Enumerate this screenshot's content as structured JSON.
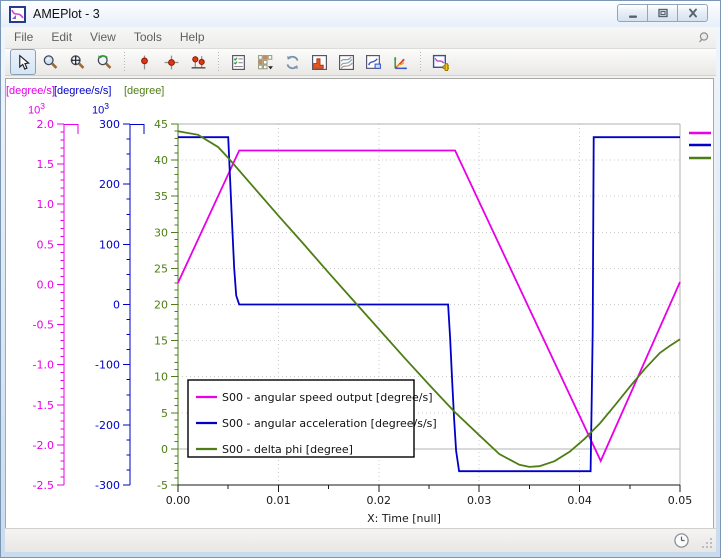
{
  "window": {
    "title": "AMEPlot - 3"
  },
  "menu": {
    "items": [
      "File",
      "Edit",
      "View",
      "Tools",
      "Help"
    ]
  },
  "toolbar": {
    "buttons": [
      {
        "name": "select-tool",
        "pressed": true
      },
      {
        "name": "zoom-tool",
        "pressed": false
      },
      {
        "name": "zoom-extents-tool",
        "pressed": false
      },
      {
        "name": "zoom-previous-tool",
        "pressed": false
      },
      {
        "name": "separator"
      },
      {
        "name": "cursor-x-tool",
        "pressed": false
      },
      {
        "name": "cursor-cross-tool",
        "pressed": false
      },
      {
        "name": "cursor-pair-tool",
        "pressed": false
      },
      {
        "name": "separator"
      },
      {
        "name": "curves-manager",
        "pressed": false
      },
      {
        "name": "layout-grid",
        "pressed": false
      },
      {
        "name": "refresh-plot",
        "pressed": false
      },
      {
        "name": "histogram-view",
        "pressed": false
      },
      {
        "name": "contour-view",
        "pressed": false
      },
      {
        "name": "copy-plot",
        "pressed": false
      },
      {
        "name": "plot-3d",
        "pressed": false
      },
      {
        "name": "separator"
      },
      {
        "name": "new-plot",
        "pressed": false
      }
    ]
  },
  "statusbar": {
    "icons": [
      "clock",
      "resize-grip"
    ]
  },
  "chart_data": {
    "type": "line",
    "title": "",
    "xlabel": "X: Time [null]",
    "grid": {
      "style": "dotted",
      "zero_line": "solid"
    },
    "x_axis": {
      "min": 0,
      "max": 0.05,
      "major": 0.01,
      "minor": 0.005,
      "tick_labels": [
        "0.00",
        "0.01",
        "0.02",
        "0.03",
        "0.04",
        "0.05"
      ]
    },
    "y_axes": [
      {
        "unit": "[degree/s]",
        "color": "#e800e8",
        "exponent": {
          "base": "10",
          "power": "3"
        },
        "min": -2.5,
        "max": 2.0,
        "major": 0.5,
        "minor": 0.1,
        "tick_labels": [
          "2.0",
          "1.5",
          "1.0",
          "0.5",
          "0.0",
          "-0.5",
          "-1.0",
          "-1.5",
          "-2.0",
          "-2.5"
        ]
      },
      {
        "unit": "[degree/s/s]",
        "color": "#0000c8",
        "exponent": {
          "base": "10",
          "power": "3"
        },
        "min": -300,
        "max": 300,
        "major": 100,
        "minor": 25,
        "tick_labels": [
          "300",
          "200",
          "100",
          "0",
          "-100",
          "-200",
          "-300"
        ]
      },
      {
        "unit": "[degree]",
        "color": "#4e7d15",
        "exponent": null,
        "min": -5,
        "max": 45,
        "major": 5,
        "minor": 1,
        "tick_labels": [
          "45",
          "40",
          "35",
          "30",
          "25",
          "20",
          "15",
          "10",
          "5",
          "0",
          "-5"
        ]
      }
    ],
    "legend": {
      "position": "inside-lower-left",
      "entries": [
        "S00 - angular speed output [degree/s]",
        "S00 - angular acceleration [degree/s/s]",
        "S00 - delta phi [degree]"
      ]
    },
    "series": [
      {
        "name": "S00 - angular speed output [degree/s]",
        "color": "#e800e8",
        "axis": 0,
        "unit_scale": "1e3",
        "points": [
          [
            0,
            0.02
          ],
          [
            0.0061,
            1.67
          ],
          [
            0.0276,
            1.67
          ],
          [
            0.0421,
            -2.2
          ],
          [
            0.05,
            0.03
          ]
        ]
      },
      {
        "name": "S00 - angular acceleration [degree/s/s]",
        "color": "#0000c8",
        "axis": 1,
        "unit_scale": "1e3",
        "points": [
          [
            0,
            278
          ],
          [
            0.005,
            278
          ],
          [
            0.0052,
            205
          ],
          [
            0.0054,
            130
          ],
          [
            0.0056,
            60
          ],
          [
            0.0058,
            15
          ],
          [
            0.0061,
            0
          ],
          [
            0.0269,
            0
          ],
          [
            0.0271,
            -55
          ],
          [
            0.0273,
            -125
          ],
          [
            0.0275,
            -190
          ],
          [
            0.0277,
            -243
          ],
          [
            0.028,
            -277
          ],
          [
            0.0411,
            -277
          ],
          [
            0.0412,
            -170
          ],
          [
            0.0413,
            -45
          ],
          [
            0.0414,
            278
          ],
          [
            0.05,
            278
          ]
        ]
      },
      {
        "name": "S00 - delta phi [degree]",
        "color": "#4e7d15",
        "axis": 2,
        "unit_scale": "1",
        "points": [
          [
            0,
            44
          ],
          [
            0.002,
            43.5
          ],
          [
            0.004,
            41.8
          ],
          [
            0.005,
            40.3
          ],
          [
            0.0075,
            36.3
          ],
          [
            0.01,
            32.3
          ],
          [
            0.0125,
            28.4
          ],
          [
            0.015,
            24.4
          ],
          [
            0.0175,
            20.5
          ],
          [
            0.02,
            16.6
          ],
          [
            0.0225,
            12.7
          ],
          [
            0.025,
            8.9
          ],
          [
            0.0275,
            5.2
          ],
          [
            0.03,
            1.9
          ],
          [
            0.032,
            -0.7
          ],
          [
            0.034,
            -2.2
          ],
          [
            0.035,
            -2.5
          ],
          [
            0.036,
            -2.4
          ],
          [
            0.0375,
            -1.7
          ],
          [
            0.039,
            -0.4
          ],
          [
            0.0405,
            1.4
          ],
          [
            0.042,
            3.5
          ],
          [
            0.0435,
            6
          ],
          [
            0.045,
            8.6
          ],
          [
            0.0465,
            11.1
          ],
          [
            0.048,
            13.3
          ],
          [
            0.049,
            14.3
          ],
          [
            0.05,
            15.2
          ]
        ]
      }
    ]
  }
}
